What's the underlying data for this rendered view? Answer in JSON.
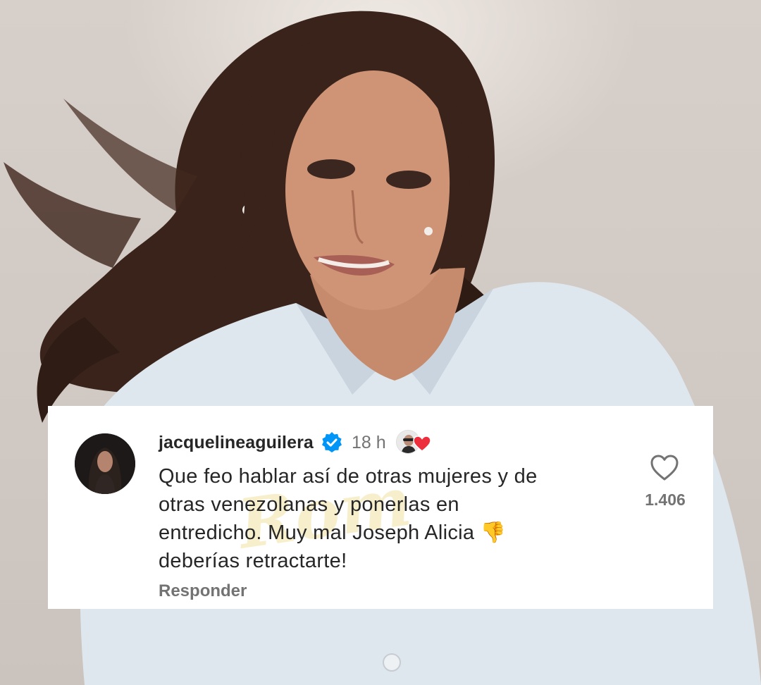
{
  "comment": {
    "username": "jacquelineaguilera",
    "time_ago": "18 h",
    "text": "Que feo hablar así de otras mujeres y de\notras venezolanas y ponerlas en\nentredicho. Muy mal Joseph Alicia 👎\ndeberías retractarte!",
    "reply_label": "Responder",
    "like_count": "1.406",
    "verified": true
  },
  "icons": {
    "verified": "verified-badge-icon",
    "like": "heart-outline-icon",
    "creator_liked": "creator-heart-badge-icon"
  },
  "colors": {
    "verified_blue": "#0095f6",
    "heart_red": "#ed2f3d",
    "text_primary": "#262626",
    "text_secondary": "#737373"
  },
  "watermark_text": "Rom"
}
